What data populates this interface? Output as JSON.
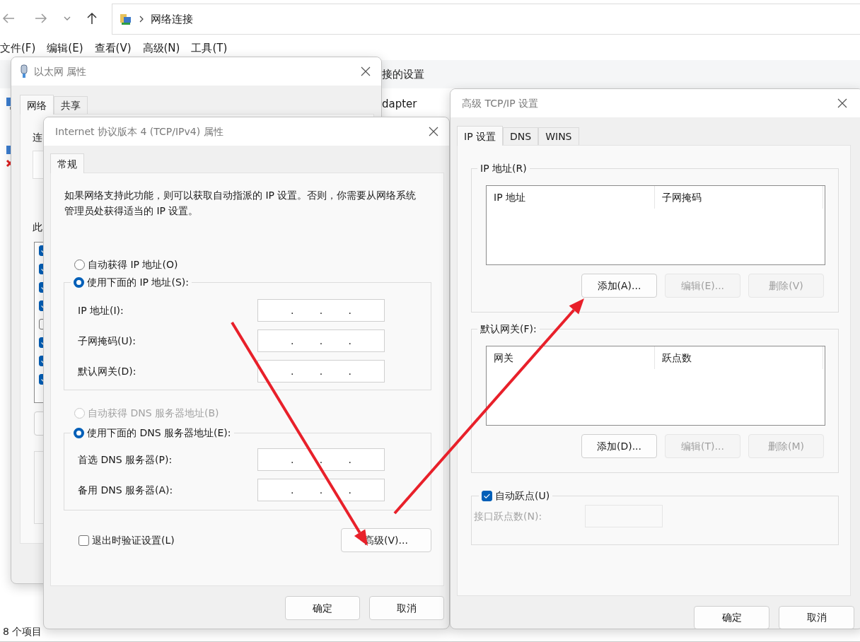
{
  "explorer": {
    "address": "网络连接",
    "menu": [
      "文件(F)",
      "编辑(E)",
      "查看(V)",
      "高级(N)",
      "工具(T)"
    ],
    "toolbar_text": "接的设置",
    "item_text": "dapter",
    "status": "8 个项目"
  },
  "ethernet_dialog": {
    "title": "以太网 属性",
    "tabs": [
      {
        "label": "网络",
        "selected": true
      },
      {
        "label": "共享",
        "selected": false
      }
    ],
    "connect_label": "连",
    "components_label": "此",
    "components": [
      {
        "checked": true
      },
      {
        "checked": true
      },
      {
        "checked": true
      },
      {
        "checked": true
      },
      {
        "checked": false
      },
      {
        "checked": true
      },
      {
        "checked": true
      },
      {
        "checked": true
      }
    ]
  },
  "ipv4_dialog": {
    "title": "Internet 协议版本 4 (TCP/IPv4) 属性",
    "tabs": [
      {
        "label": "常规",
        "selected": true
      }
    ],
    "description": "如果网络支持此功能，则可以获取自动指派的 IP 设置。否则，你需要从网络系统管理员处获得适当的 IP 设置。",
    "ip_options": [
      {
        "label": "自动获得 IP 地址(O)",
        "selected": false,
        "disabled": false
      },
      {
        "label": "使用下面的 IP 地址(S):",
        "selected": true,
        "disabled": false
      }
    ],
    "ip_fields": [
      {
        "label": "IP 地址(I):",
        "separator": "."
      },
      {
        "label": "子网掩码(U):",
        "separator": "."
      },
      {
        "label": "默认网关(D):",
        "separator": "."
      }
    ],
    "dns_options": [
      {
        "label": "自动获得 DNS 服务器地址(B)",
        "selected": false,
        "disabled": true
      },
      {
        "label": "使用下面的 DNS 服务器地址(E):",
        "selected": true,
        "disabled": false
      }
    ],
    "dns_fields": [
      {
        "label": "首选 DNS 服务器(P):",
        "separator": "."
      },
      {
        "label": "备用 DNS 服务器(A):",
        "separator": "."
      }
    ],
    "validate": {
      "label": "退出时验证设置(L)",
      "checked": false
    },
    "advanced_button": "高级(V)...",
    "buttons": [
      "确定",
      "取消"
    ]
  },
  "advanced_dialog": {
    "title": "高级 TCP/IP 设置",
    "tabs": [
      {
        "label": "IP 设置",
        "selected": true
      },
      {
        "label": "DNS",
        "selected": false
      },
      {
        "label": "WINS",
        "selected": false
      }
    ],
    "ip_group": {
      "legend": "IP 地址(R)",
      "columns": [
        "IP 地址",
        "子网掩码"
      ],
      "buttons": [
        {
          "label": "添加(A)...",
          "disabled": false
        },
        {
          "label": "编辑(E)...",
          "disabled": true
        },
        {
          "label": "删除(V)",
          "disabled": true
        }
      ]
    },
    "gateway_group": {
      "legend": "默认网关(F):",
      "columns": [
        "网关",
        "跃点数"
      ],
      "buttons": [
        {
          "label": "添加(D)...",
          "disabled": false
        },
        {
          "label": "编辑(T)...",
          "disabled": true
        },
        {
          "label": "删除(M)",
          "disabled": true
        }
      ]
    },
    "auto_metric": {
      "label": "自动跃点(U)",
      "checked": true
    },
    "metric_field": {
      "label": "接口跃点数(N):",
      "disabled": true
    },
    "buttons": [
      "确定",
      "取消"
    ]
  }
}
